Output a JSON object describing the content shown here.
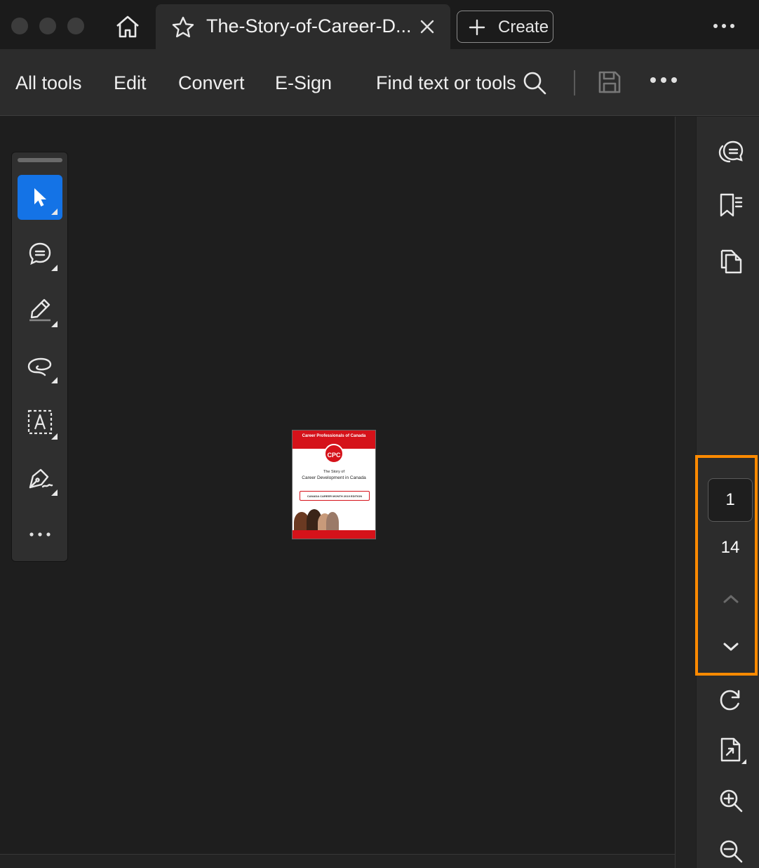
{
  "window": {
    "tab_title": "The-Story-of-Career-D...",
    "create_label": "Create",
    "icons": [
      "home-icon",
      "star-icon",
      "close-icon",
      "plus-icon",
      "more-icon"
    ]
  },
  "menu": {
    "items": [
      "All tools",
      "Edit",
      "Convert",
      "E-Sign"
    ],
    "find_label": "Find text or tools",
    "icons": [
      "search-icon",
      "save-icon",
      "more-icon"
    ]
  },
  "quick_tools": {
    "icons": [
      "select-cursor-icon",
      "comment-icon",
      "highlight-pen-icon",
      "lasso-draw-icon",
      "text-box-icon",
      "sign-pen-icon",
      "more-icon"
    ],
    "active": "select-cursor-icon"
  },
  "document": {
    "org": "Career Professionals of Canada",
    "logo": "CPC",
    "subtitle": "The Story of",
    "title": "Career Development in Canada",
    "edition": "CANADA CAREER MONTH 2019 EDITION",
    "colors": {
      "brand_red": "#d5121a"
    }
  },
  "right_rail": {
    "icons": [
      "comments-panel-icon",
      "bookmarks-icon",
      "copy-pages-icon",
      "rotate-icon",
      "page-extract-icon",
      "zoom-in-icon",
      "zoom-out-icon"
    ]
  },
  "page_nav": {
    "current_page": "1",
    "total_pages": "14",
    "highlight_color": "#ff8a00"
  }
}
